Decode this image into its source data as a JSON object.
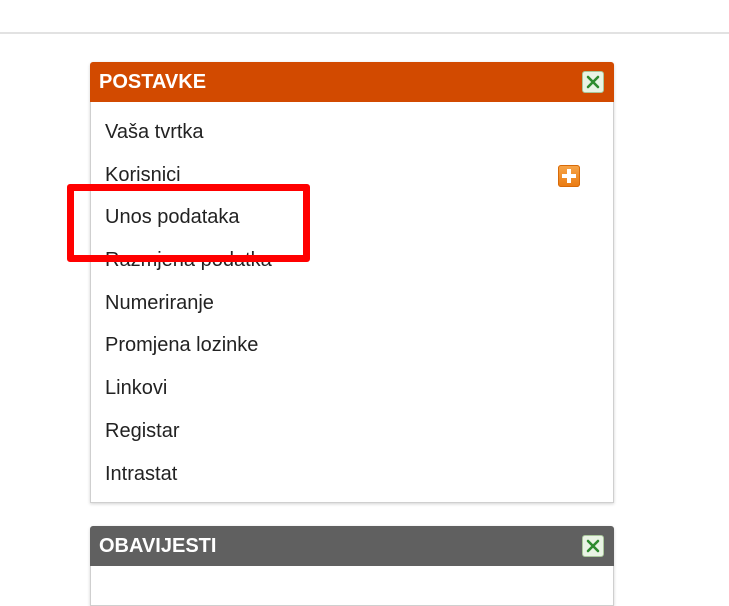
{
  "settings_panel": {
    "title": "POSTAVKE",
    "header_color": "#d24a00",
    "close_icon": "close-icon",
    "items": [
      {
        "label": "Vaša tvrtka"
      },
      {
        "label": "Korisnici",
        "icon": "plus-icon"
      },
      {
        "label": "Unos podataka"
      },
      {
        "label": "Razmjena podatka"
      },
      {
        "label": "Numeriranje"
      },
      {
        "label": "Promjena lozinke"
      },
      {
        "label": "Linkovi"
      },
      {
        "label": "Registar"
      },
      {
        "label": "Intrastat"
      }
    ]
  },
  "notices_panel": {
    "title": "OBAVIJESTI",
    "header_color": "#606060",
    "close_icon": "close-icon"
  },
  "annotation": {
    "highlight_color": "#ff0000",
    "highlighted_item": "Unos podataka"
  }
}
